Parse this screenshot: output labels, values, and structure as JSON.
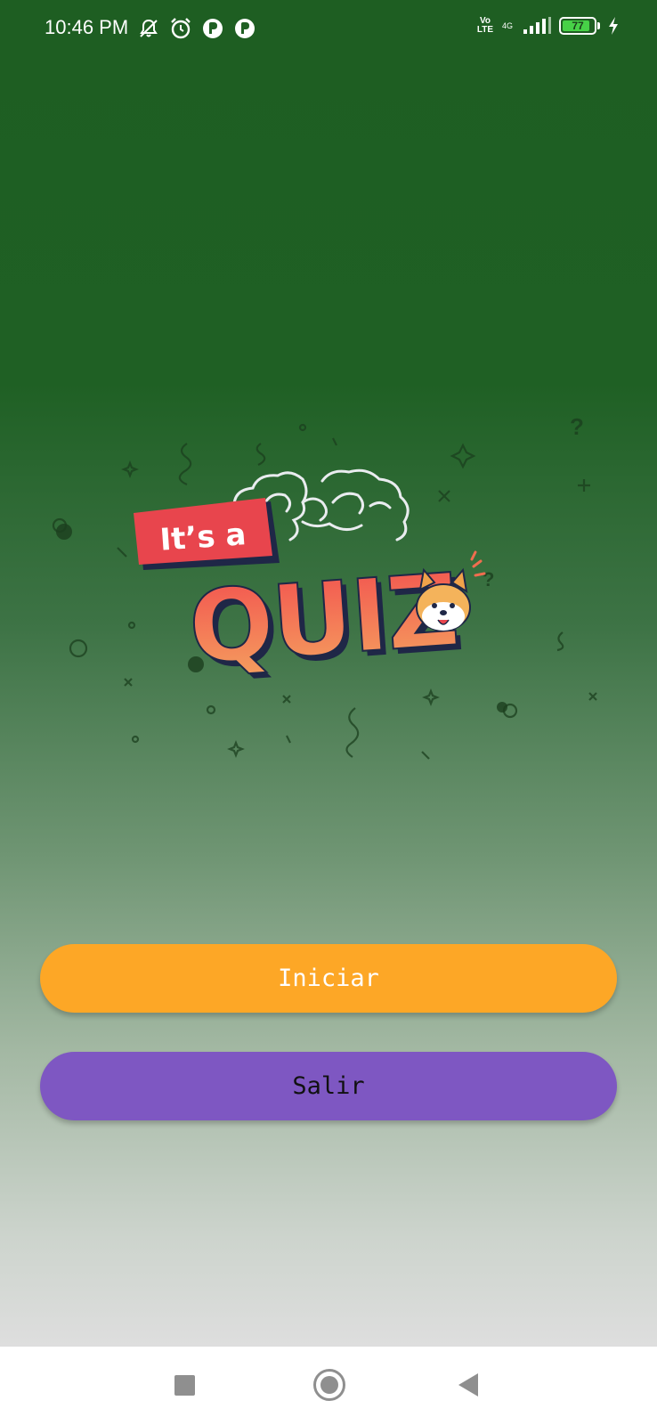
{
  "status_bar": {
    "time": "10:46 PM",
    "left_icons": [
      "muted-notification-icon",
      "alarm-icon",
      "app-notification-icon",
      "app-notification-icon"
    ],
    "volte": "Vo LTE",
    "network": "4G",
    "battery_level": "77",
    "charging": true
  },
  "logo": {
    "line1": "It’s a",
    "line2": "QUIZ",
    "colors": {
      "banner": "#e8454d",
      "quiz_gradient_top": "#f2504f",
      "quiz_gradient_bottom": "#f5a25f",
      "outline": "#1f2747"
    }
  },
  "buttons": {
    "start_label": "Iniciar",
    "exit_label": "Salir"
  },
  "colors": {
    "background_top": "#1e5e22",
    "background_bottom": "#dedede",
    "start_button": "#fda726",
    "exit_button": "#7e57c2"
  },
  "nav_bar": {
    "buttons": [
      "recent-apps-icon",
      "home-icon",
      "back-icon"
    ]
  }
}
